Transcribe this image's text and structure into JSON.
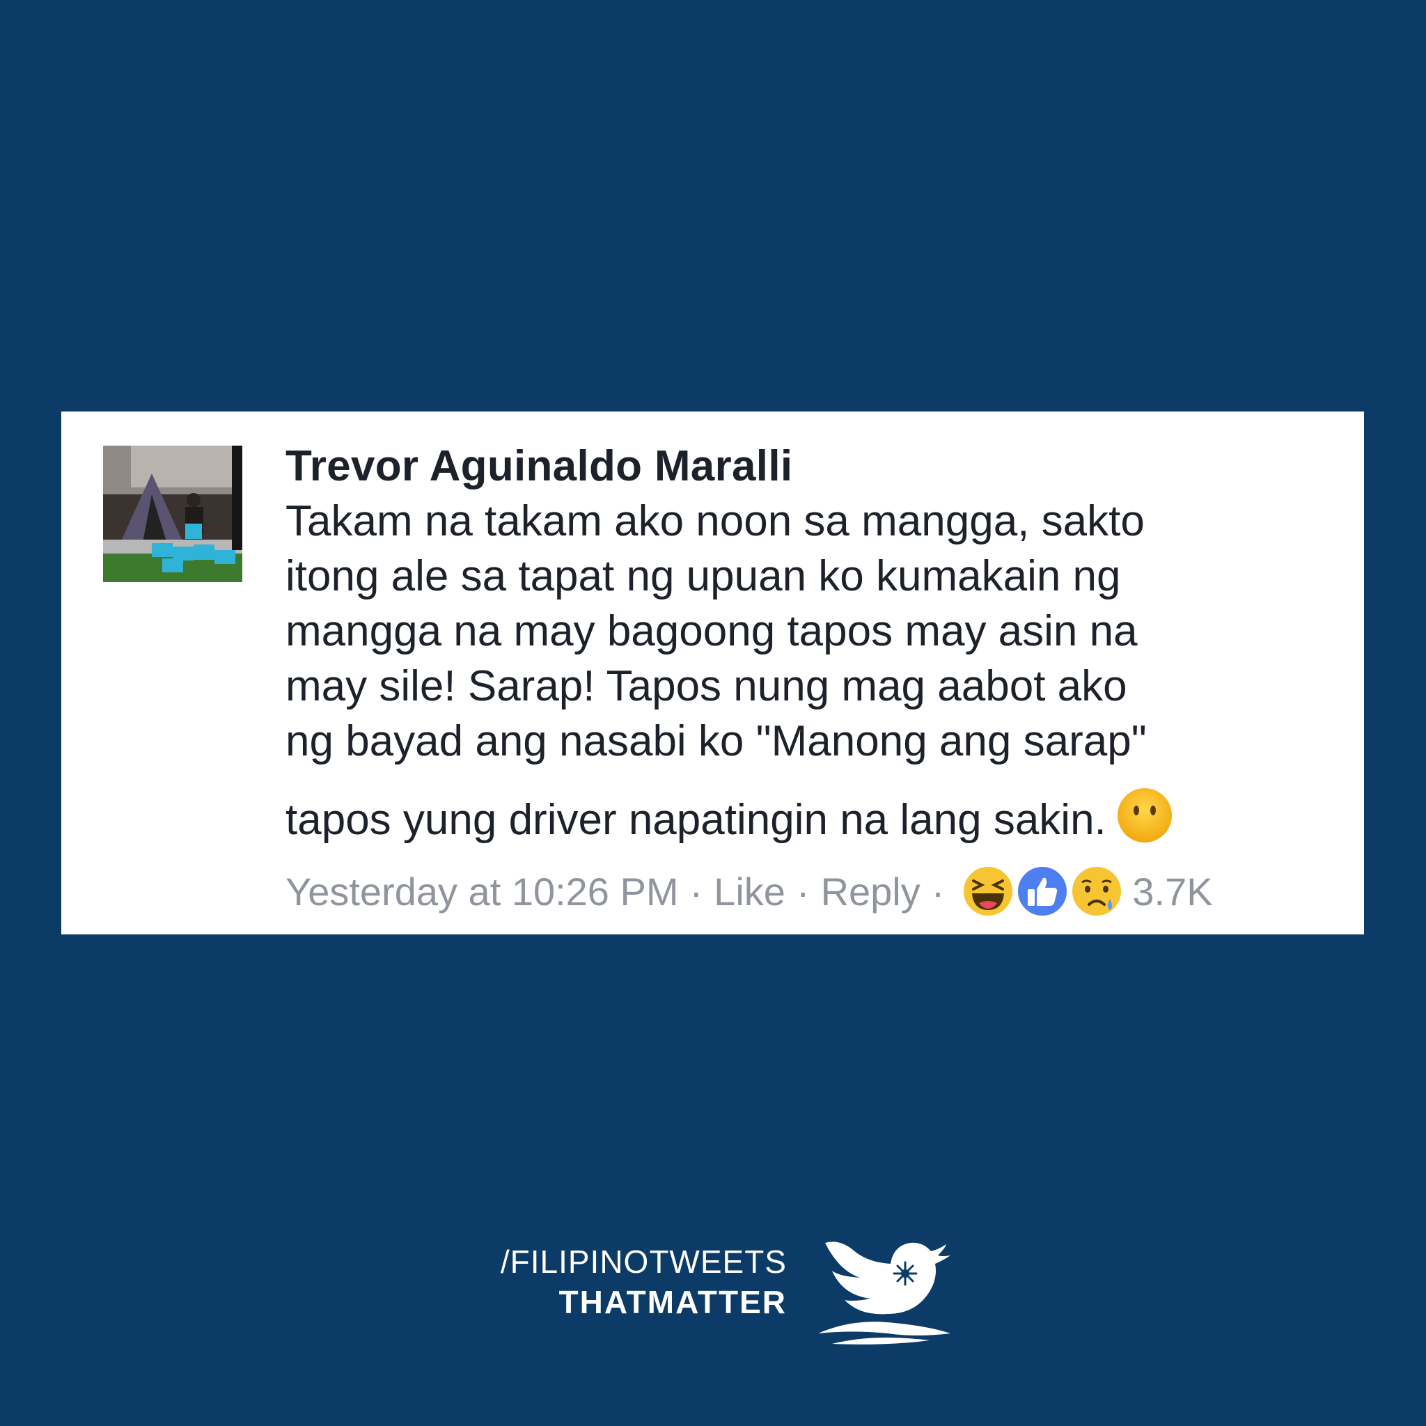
{
  "post": {
    "author": "Trevor Aguinaldo Maralli",
    "lines": [
      "Takam na takam ako noon sa mangga, sakto",
      "itong ale sa tapat ng upuan ko kumakain ng",
      "mangga na may bagoong tapos may asin na",
      "may sile! Sarap! Tapos nung mag aabot ako",
      "ng bayad ang nasabi ko \"Manong ang sarap\"",
      "tapos yung driver napatingin na lang sakin."
    ],
    "end_emoji": "no-mouth-face-icon",
    "timestamp": "Yesterday at 10:26 PM",
    "separator": "·",
    "like_label": "Like",
    "reply_label": "Reply",
    "reactions": [
      "haha-icon",
      "like-icon",
      "sad-icon"
    ],
    "reaction_count": "3.7K"
  },
  "brand": {
    "line1": "/FILIPINOTWEETS",
    "line2": "THATMATTER"
  },
  "colors": {
    "background": "#0b3b66",
    "card": "#ffffff",
    "text": "#1d2129",
    "meta": "#90949c",
    "like_blue": "#4e7ff0",
    "emoji_yellow": "#f7c531"
  }
}
